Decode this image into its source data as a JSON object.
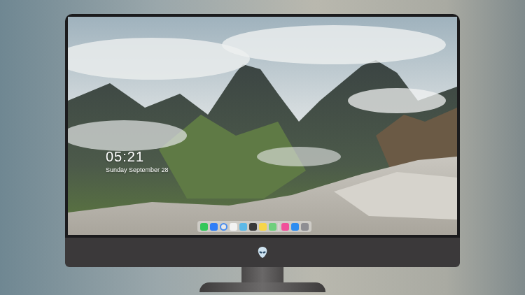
{
  "lock_screen": {
    "time": "05:21",
    "date": "Sunday September 28"
  }
}
